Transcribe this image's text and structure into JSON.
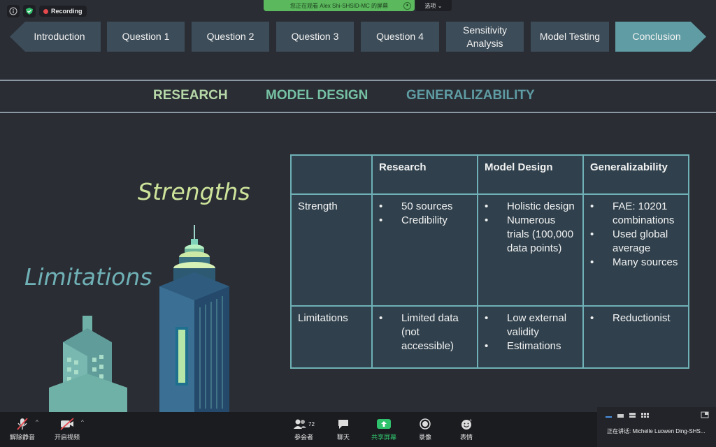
{
  "topbar": {
    "recording_label": "Recording",
    "viewing_text": "您正在观看 Alex Shi-SHSID-MC 的屏幕",
    "options_label": "选项 ⌄"
  },
  "nav": {
    "items": [
      {
        "label": "Introduction"
      },
      {
        "label": "Question 1"
      },
      {
        "label": "Question 2"
      },
      {
        "label": "Question 3"
      },
      {
        "label": "Question 4"
      },
      {
        "label": "Sensitivity Analysis"
      },
      {
        "label": "Model Testing"
      },
      {
        "label": "Conclusion",
        "active": true
      }
    ]
  },
  "subtabs": [
    {
      "label": "RESEARCH",
      "color": "#b6d7a8"
    },
    {
      "label": "MODEL DESIGN",
      "color": "#76c1a4"
    },
    {
      "label": "GENERALIZABILITY",
      "color": "#5f9ca3"
    }
  ],
  "headings": {
    "strengths": "Strengths",
    "limitations": "Limitations"
  },
  "table": {
    "headers": [
      "",
      "Research",
      "Model Design",
      "Generalizability"
    ],
    "rows": [
      {
        "label": "Strength",
        "cells": [
          [
            "50 sources",
            "Credibility"
          ],
          [
            "Holistic design",
            "Numerous trials (100,000 data points)"
          ],
          [
            "FAE: 10201 combinations",
            "Used global average",
            "Many sources"
          ]
        ]
      },
      {
        "label": "Limitations",
        "cells": [
          [
            "Limited data (not accessible)"
          ],
          [
            "Low external validity",
            "Estimations"
          ],
          [
            "Reductionist"
          ]
        ]
      }
    ]
  },
  "bottombar": {
    "unmute": "解除静音",
    "start_video": "开启视频",
    "participants": "参会者",
    "participants_count": "72",
    "chat": "聊天",
    "share": "共享屏幕",
    "record": "录像",
    "reactions": "表情",
    "speaker": "正在讲话: Michelle Luowen Ding-SHS..."
  },
  "colors": {
    "active_nav": "#5f9ca3",
    "share_green": "#2fc16b",
    "recording_red": "#e5484d"
  }
}
